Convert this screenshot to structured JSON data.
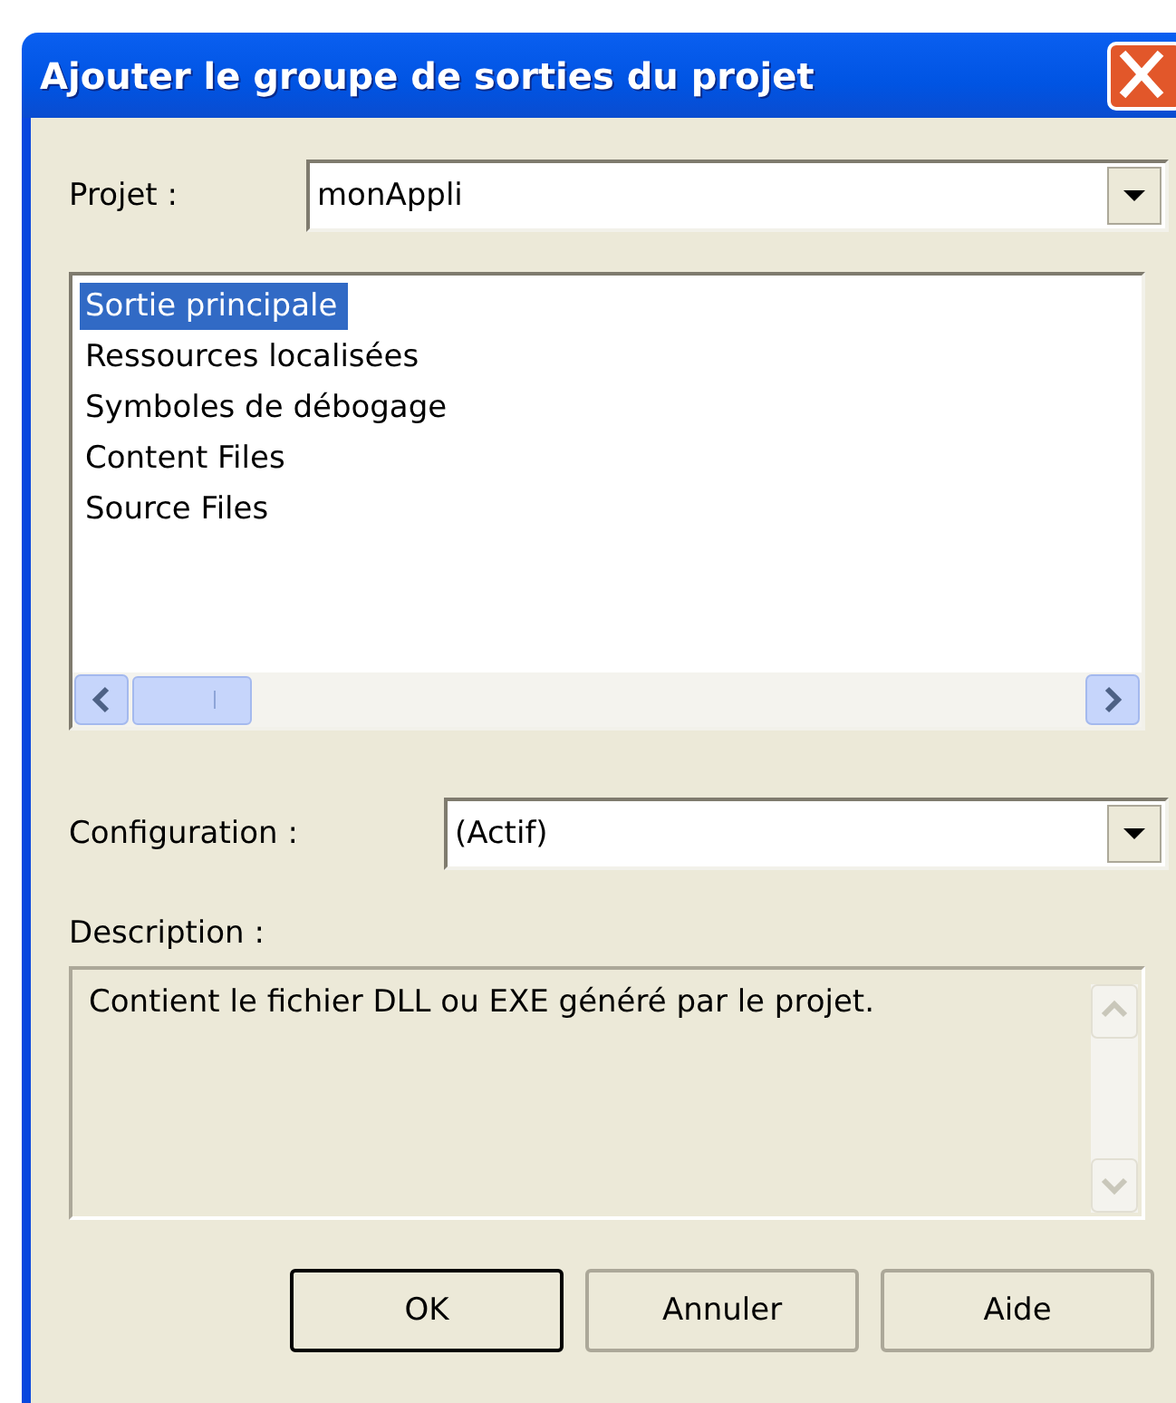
{
  "window": {
    "title": "Ajouter le groupe de sorties du projet"
  },
  "project": {
    "label": "Projet :",
    "value": "monAppli"
  },
  "outputs": [
    {
      "label": "Sortie principale",
      "selected": true
    },
    {
      "label": "Ressources localisées",
      "selected": false
    },
    {
      "label": "Symboles de débogage",
      "selected": false
    },
    {
      "label": "Content Files",
      "selected": false
    },
    {
      "label": "Source Files",
      "selected": false
    }
  ],
  "configuration": {
    "label": "Configuration :",
    "value": "(Actif)"
  },
  "description": {
    "label": "Description :",
    "text": "Contient le fichier DLL ou EXE généré par le projet."
  },
  "buttons": [
    {
      "label": "OK",
      "default": true
    },
    {
      "label": "Annuler",
      "default": false
    },
    {
      "label": "Aide",
      "default": false
    }
  ]
}
